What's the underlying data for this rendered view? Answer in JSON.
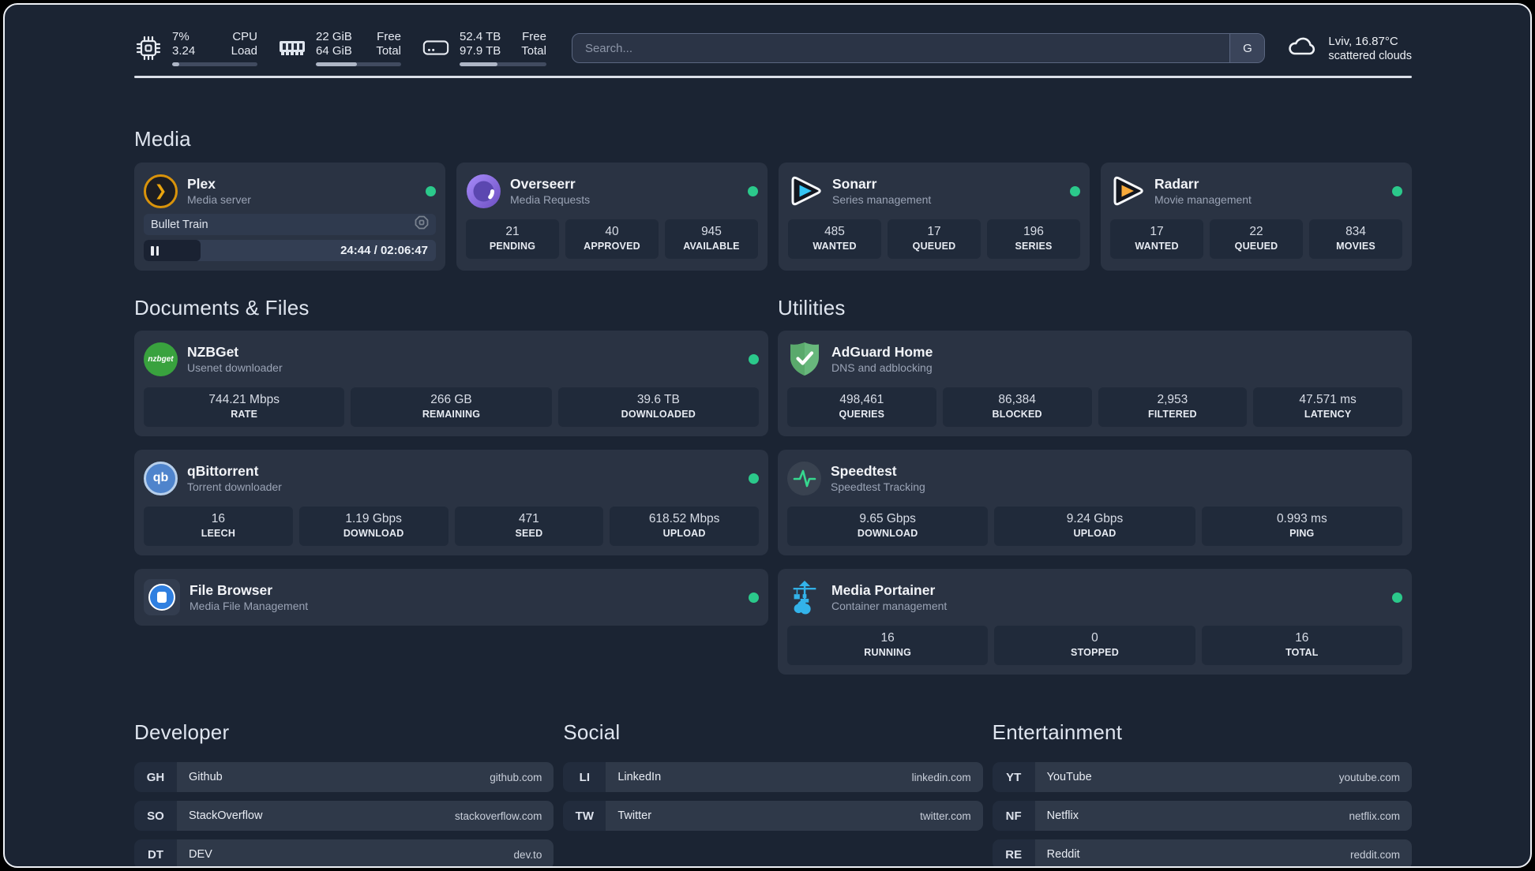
{
  "header": {
    "metrics": [
      {
        "icon": "cpu-icon",
        "left_top": "7%",
        "left_bottom": "3.24",
        "right_top": "CPU",
        "right_bottom": "Load",
        "progress_pct": 8
      },
      {
        "icon": "memory-icon",
        "left_top": "22 GiB",
        "left_bottom": "64 GiB",
        "right_top": "Free",
        "right_bottom": "Total",
        "progress_pct": 48
      },
      {
        "icon": "disk-icon",
        "left_top": "52.4 TB",
        "left_bottom": "97.9 TB",
        "right_top": "Free",
        "right_bottom": "Total",
        "progress_pct": 44
      }
    ],
    "search": {
      "placeholder": "Search...",
      "button": "G"
    },
    "weather": {
      "line1": "Lviv, 16.87°C",
      "line2": "scattered clouds"
    }
  },
  "sections": {
    "media": {
      "title": "Media",
      "plex": {
        "name": "Plex",
        "desc": "Media server",
        "player_title": "Bullet Train",
        "time": "24:44 / 02:06:47",
        "progress_pct": 19.5
      },
      "overseerr": {
        "name": "Overseerr",
        "desc": "Media Requests",
        "stats": [
          {
            "value": "21",
            "label": "PENDING"
          },
          {
            "value": "40",
            "label": "APPROVED"
          },
          {
            "value": "945",
            "label": "AVAILABLE"
          }
        ]
      },
      "sonarr": {
        "name": "Sonarr",
        "desc": "Series management",
        "stats": [
          {
            "value": "485",
            "label": "WANTED"
          },
          {
            "value": "17",
            "label": "QUEUED"
          },
          {
            "value": "196",
            "label": "SERIES"
          }
        ]
      },
      "radarr": {
        "name": "Radarr",
        "desc": "Movie management",
        "stats": [
          {
            "value": "17",
            "label": "WANTED"
          },
          {
            "value": "22",
            "label": "QUEUED"
          },
          {
            "value": "834",
            "label": "MOVIES"
          }
        ]
      }
    },
    "documents": {
      "title": "Documents & Files",
      "nzbget": {
        "name": "NZBGet",
        "desc": "Usenet downloader",
        "icon_label": "nzbget",
        "stats": [
          {
            "value": "744.21 Mbps",
            "label": "RATE"
          },
          {
            "value": "266 GB",
            "label": "REMAINING"
          },
          {
            "value": "39.6 TB",
            "label": "DOWNLOADED"
          }
        ]
      },
      "qbittorrent": {
        "name": "qBittorrent",
        "desc": "Torrent downloader",
        "icon_label": "qb",
        "stats": [
          {
            "value": "16",
            "label": "LEECH"
          },
          {
            "value": "1.19 Gbps",
            "label": "DOWNLOAD"
          },
          {
            "value": "471",
            "label": "SEED"
          },
          {
            "value": "618.52 Mbps",
            "label": "UPLOAD"
          }
        ]
      },
      "filebrowser": {
        "name": "File Browser",
        "desc": "Media File Management"
      }
    },
    "utilities": {
      "title": "Utilities",
      "adguard": {
        "name": "AdGuard Home",
        "desc": "DNS and adblocking",
        "stats": [
          {
            "value": "498,461",
            "label": "QUERIES"
          },
          {
            "value": "86,384",
            "label": "BLOCKED"
          },
          {
            "value": "2,953",
            "label": "FILTERED"
          },
          {
            "value": "47.571 ms",
            "label": "LATENCY"
          }
        ]
      },
      "speedtest": {
        "name": "Speedtest",
        "desc": "Speedtest Tracking",
        "stats": [
          {
            "value": "9.65 Gbps",
            "label": "DOWNLOAD"
          },
          {
            "value": "9.24 Gbps",
            "label": "UPLOAD"
          },
          {
            "value": "0.993 ms",
            "label": "PING"
          }
        ]
      },
      "portainer": {
        "name": "Media Portainer",
        "desc": "Container management",
        "stats": [
          {
            "value": "16",
            "label": "RUNNING"
          },
          {
            "value": "0",
            "label": "STOPPED"
          },
          {
            "value": "16",
            "label": "TOTAL"
          }
        ]
      }
    }
  },
  "bookmarks": {
    "developer": {
      "title": "Developer",
      "items": [
        {
          "abbr": "GH",
          "name": "Github",
          "url": "github.com"
        },
        {
          "abbr": "SO",
          "name": "StackOverflow",
          "url": "stackoverflow.com"
        },
        {
          "abbr": "DT",
          "name": "DEV",
          "url": "dev.to"
        }
      ]
    },
    "social": {
      "title": "Social",
      "items": [
        {
          "abbr": "LI",
          "name": "LinkedIn",
          "url": "linkedin.com"
        },
        {
          "abbr": "TW",
          "name": "Twitter",
          "url": "twitter.com"
        }
      ]
    },
    "entertainment": {
      "title": "Entertainment",
      "items": [
        {
          "abbr": "YT",
          "name": "YouTube",
          "url": "youtube.com"
        },
        {
          "abbr": "NF",
          "name": "Netflix",
          "url": "netflix.com"
        },
        {
          "abbr": "RE",
          "name": "Reddit",
          "url": "reddit.com"
        }
      ]
    }
  },
  "colors": {
    "accent_green": "#2bc98b",
    "background": "#1b2433",
    "card": "#2a3343"
  }
}
